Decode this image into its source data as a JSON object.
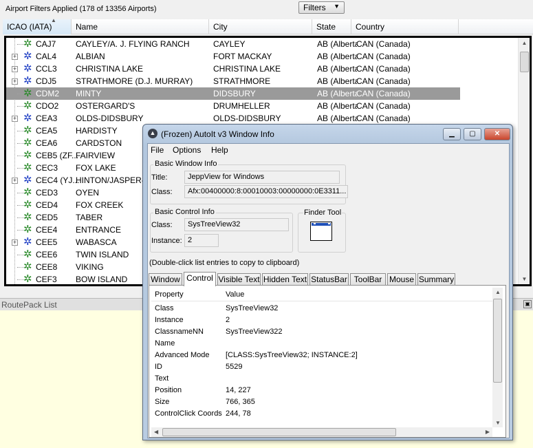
{
  "topbar": {
    "status": "Airport Filters Applied (178 of 13356 Airports)",
    "filters_label": "Filters"
  },
  "columns": [
    "ICAO (IATA)",
    "Name",
    "City",
    "State",
    "Country"
  ],
  "rows": [
    {
      "icao": "CAJ7",
      "name": "CAYLEY/A. J. FLYING RANCH",
      "city": "CAYLEY",
      "state": "AB (Alberta)",
      "country": "CAN (Canada)",
      "expander": false
    },
    {
      "icao": "CAL4",
      "name": "ALBIAN",
      "city": "FORT MACKAY",
      "state": "AB (Alberta)",
      "country": "CAN (Canada)",
      "expander": true
    },
    {
      "icao": "CCL3",
      "name": "CHRISTINA LAKE",
      "city": "CHRISTINA LAKE",
      "state": "AB (Alberta)",
      "country": "CAN (Canada)",
      "expander": true
    },
    {
      "icao": "CDJ5",
      "name": "STRATHMORE (D.J. MURRAY)",
      "city": "STRATHMORE",
      "state": "AB (Alberta)",
      "country": "CAN (Canada)",
      "expander": true
    },
    {
      "icao": "CDM2",
      "name": "MINTY",
      "city": "DIDSBURY",
      "state": "AB (Alberta)",
      "country": "CAN (Canada)",
      "expander": false,
      "selected": true
    },
    {
      "icao": "CDO2",
      "name": "OSTERGARD'S",
      "city": "DRUMHELLER",
      "state": "AB (Alberta)",
      "country": "CAN (Canada)",
      "expander": false
    },
    {
      "icao": "CEA3",
      "name": "OLDS-DIDSBURY",
      "city": "OLDS-DIDSBURY",
      "state": "AB (Alberta)",
      "country": "CAN (Canada)",
      "expander": true
    },
    {
      "icao": "CEA5",
      "name": "HARDISTY",
      "city": "",
      "state": "",
      "country": "",
      "expander": false
    },
    {
      "icao": "CEA6",
      "name": "CARDSTON",
      "city": "",
      "state": "",
      "country": "",
      "expander": false
    },
    {
      "icao": "CEB5 (ZF...",
      "name": "FAIRVIEW",
      "city": "",
      "state": "",
      "country": "",
      "expander": false
    },
    {
      "icao": "CEC3",
      "name": "FOX LAKE",
      "city": "",
      "state": "",
      "country": "",
      "expander": false
    },
    {
      "icao": "CEC4 (YJ...",
      "name": "HINTON/JASPER-H...",
      "city": "",
      "state": "",
      "country": "",
      "expander": true
    },
    {
      "icao": "CED3",
      "name": "OYEN",
      "city": "",
      "state": "",
      "country": "",
      "expander": false
    },
    {
      "icao": "CED4",
      "name": "FOX CREEK",
      "city": "",
      "state": "",
      "country": "",
      "expander": false
    },
    {
      "icao": "CED5",
      "name": "TABER",
      "city": "",
      "state": "",
      "country": "",
      "expander": false
    },
    {
      "icao": "CEE4",
      "name": "ENTRANCE",
      "city": "",
      "state": "",
      "country": "",
      "expander": false
    },
    {
      "icao": "CEE5",
      "name": "WABASCA",
      "city": "",
      "state": "",
      "country": "",
      "expander": true
    },
    {
      "icao": "CEE6",
      "name": "TWIN ISLAND",
      "city": "",
      "state": "",
      "country": "",
      "expander": false
    },
    {
      "icao": "CEE8",
      "name": "VIKING",
      "city": "",
      "state": "",
      "country": "",
      "expander": false
    },
    {
      "icao": "CEF3",
      "name": "BOW ISLAND",
      "city": "",
      "state": "",
      "country": "",
      "expander": false
    }
  ],
  "routepack": {
    "label": "RoutePack List"
  },
  "autoit": {
    "title": "(Frozen) AutoIt v3 Window Info",
    "menu": [
      "File",
      "Options",
      "Help"
    ],
    "basic_window": {
      "group_title": "Basic Window Info",
      "title_label": "Title:",
      "title_value": "JeppView for Windows",
      "class_label": "Class:",
      "class_value": "Afx:00400000:8:00010003:00000000:0E3311..."
    },
    "basic_control": {
      "group_title": "Basic Control Info",
      "class_label": "Class:",
      "class_value": "SysTreeView32",
      "instance_label": "Instance:",
      "instance_value": "2"
    },
    "finder_tool": "Finder Tool",
    "hint": "(Double-click list entries to copy to clipboard)",
    "tabs": [
      "Window",
      "Control",
      "Visible Text",
      "Hidden Text",
      "StatusBar",
      "ToolBar",
      "Mouse",
      "Summary"
    ],
    "active_tab": "Control",
    "list_header": {
      "property": "Property",
      "value": "Value"
    },
    "properties": [
      {
        "k": "Class",
        "v": "SysTreeView32"
      },
      {
        "k": "Instance",
        "v": "2"
      },
      {
        "k": "ClassnameNN",
        "v": "SysTreeView322"
      },
      {
        "k": "Name",
        "v": ""
      },
      {
        "k": "Advanced Mode",
        "v": "[CLASS:SysTreeView32; INSTANCE:2]"
      },
      {
        "k": "ID",
        "v": "5529"
      },
      {
        "k": "Text",
        "v": ""
      },
      {
        "k": "Position",
        "v": "14, 227"
      },
      {
        "k": "Size",
        "v": "766, 365"
      },
      {
        "k": "ControlClick Coords",
        "v": "244, 78"
      }
    ]
  },
  "colors": {
    "selection": "#9a9a9a",
    "gear": "#2a8a2a",
    "gear_blue": "#1f3fc4",
    "tooltip_bg": "#ffffe1"
  }
}
